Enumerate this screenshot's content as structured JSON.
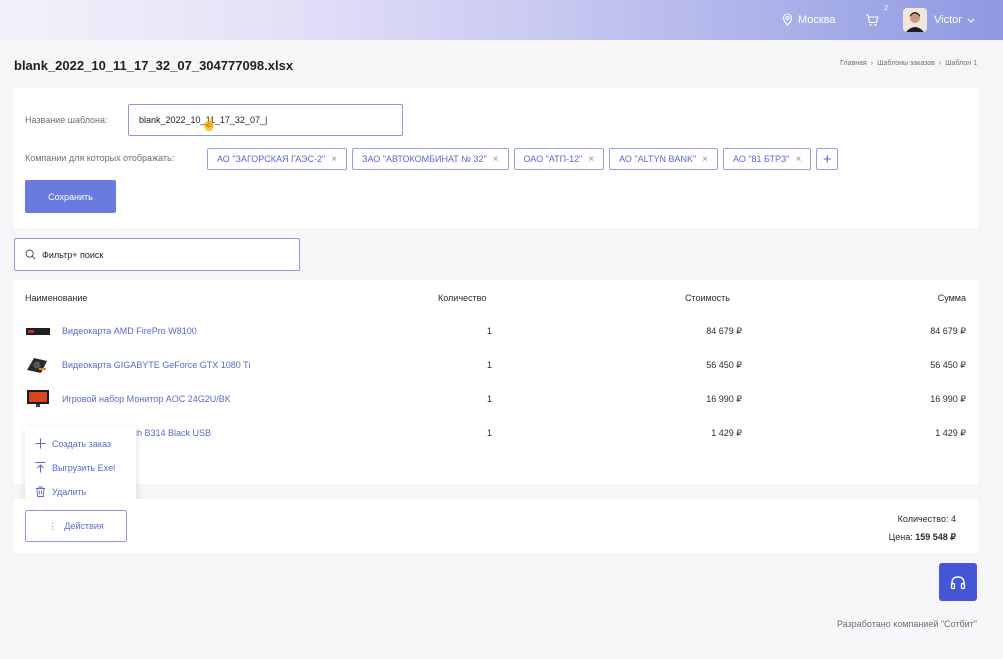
{
  "header": {
    "city": "Москва",
    "cart_count": "2",
    "user_name": "Victor"
  },
  "page": {
    "title": "blank_2022_10_11_17_32_07_304777098.xlsx",
    "breadcrumbs": [
      "Главная",
      "Шаблоны заказов",
      "Шаблон 1"
    ]
  },
  "template_form": {
    "name_label": "Название шаблона:",
    "name_value": "blank_2022_10_11_17_32_07_|",
    "companies_label": "Компании для которых отображать:",
    "companies": [
      "АО \"ЗАГОРСКАЯ ГАЭС-2\"",
      "ЗАО \"АВТОКОМБИНАТ № 32\"",
      "ОАО \"АТП-12\"",
      "АО \"ALTYN BANK\"",
      "АО \"81 БТРЗ\""
    ],
    "add_symbol": "+",
    "save_label": "Сохранить"
  },
  "search": {
    "value": "Фильтр+ поиск"
  },
  "table": {
    "headers": [
      "Наименование",
      "Количество",
      "Стоимость",
      "Сумма"
    ],
    "rows": [
      {
        "name": "Видеокарта AMD FirePro W8100",
        "qty": "1",
        "cost": "84 679 ₽",
        "sum": "84 679 ₽"
      },
      {
        "name": "Видеокарта GIGABYTE GeForce GTX 1080 Ti",
        "qty": "1",
        "cost": "56 450 ₽",
        "sum": "56 450 ₽"
      },
      {
        "name": "Игровой набор Монитор AOC 24G2U/BK",
        "qty": "1",
        "cost": "16 990 ₽",
        "sum": "16 990 ₽"
      },
      {
        "name": "tech B314 Black USB",
        "qty": "1",
        "cost": "1 429 ₽",
        "sum": "1 429 ₽"
      }
    ]
  },
  "actions_menu": {
    "items": [
      "Создать заказ",
      "Выгрузить Exel",
      "Удалить"
    ]
  },
  "footer": {
    "actions_label": "Действия",
    "quantity_text": "Количество: 4",
    "price_label": "Цена:",
    "price_value": "159 548 ₽",
    "developer": "Разработано компанией \"Сотбит\""
  },
  "colors": {
    "accent": "#5a66d6",
    "button": "#6a7bdf",
    "support": "#4455d6"
  }
}
